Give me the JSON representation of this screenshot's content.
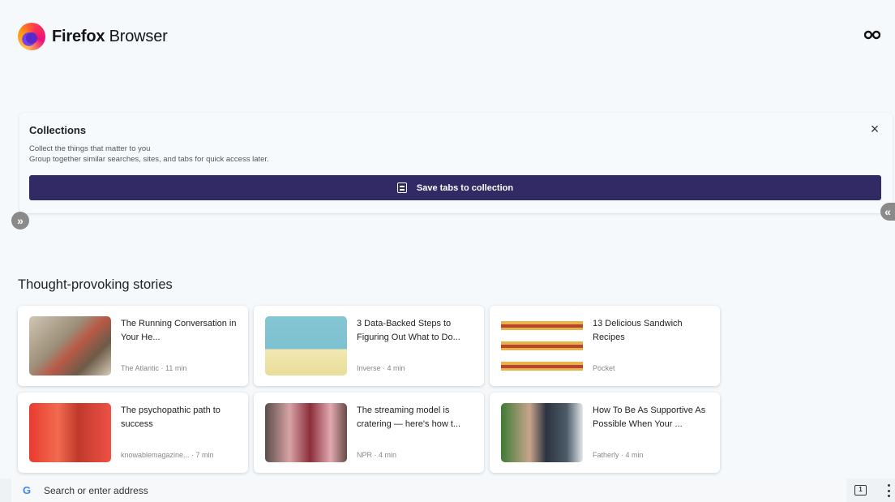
{
  "header": {
    "brand_bold": "Firefox",
    "brand_regular": " Browser",
    "private_icon": "private-mask-icon"
  },
  "collections": {
    "title": "Collections",
    "description_line1": "Collect the things that matter to you",
    "description_line2": "Group together similar searches, sites, and tabs for quick access later.",
    "close_label": "×",
    "save_button_label": "Save tabs to collection",
    "button_color": "#312a65"
  },
  "scroll": {
    "left_label": "»",
    "right_label": "«"
  },
  "stories": {
    "title": "Thought-provoking stories",
    "items": [
      {
        "title": "The Running Conversation in Your He...",
        "meta": "The Atlantic · 11 min"
      },
      {
        "title": "3 Data-Backed Steps to Figuring Out What to Do...",
        "meta": "Inverse · 4 min"
      },
      {
        "title": "13 Delicious Sandwich Recipes",
        "meta": "Pocket"
      },
      {
        "title": "The psychopathic path to success",
        "meta": "knowablemagazine... · 7 min"
      },
      {
        "title": "The streaming model is cratering — here's how t...",
        "meta": "NPR · 4 min"
      },
      {
        "title": "How To Be As Supportive As Possible When Your ...",
        "meta": "Fatherly · 4 min"
      }
    ]
  },
  "address_bar": {
    "placeholder": "Search or enter address",
    "search_engine_icon": "G",
    "tab_count": "1"
  }
}
